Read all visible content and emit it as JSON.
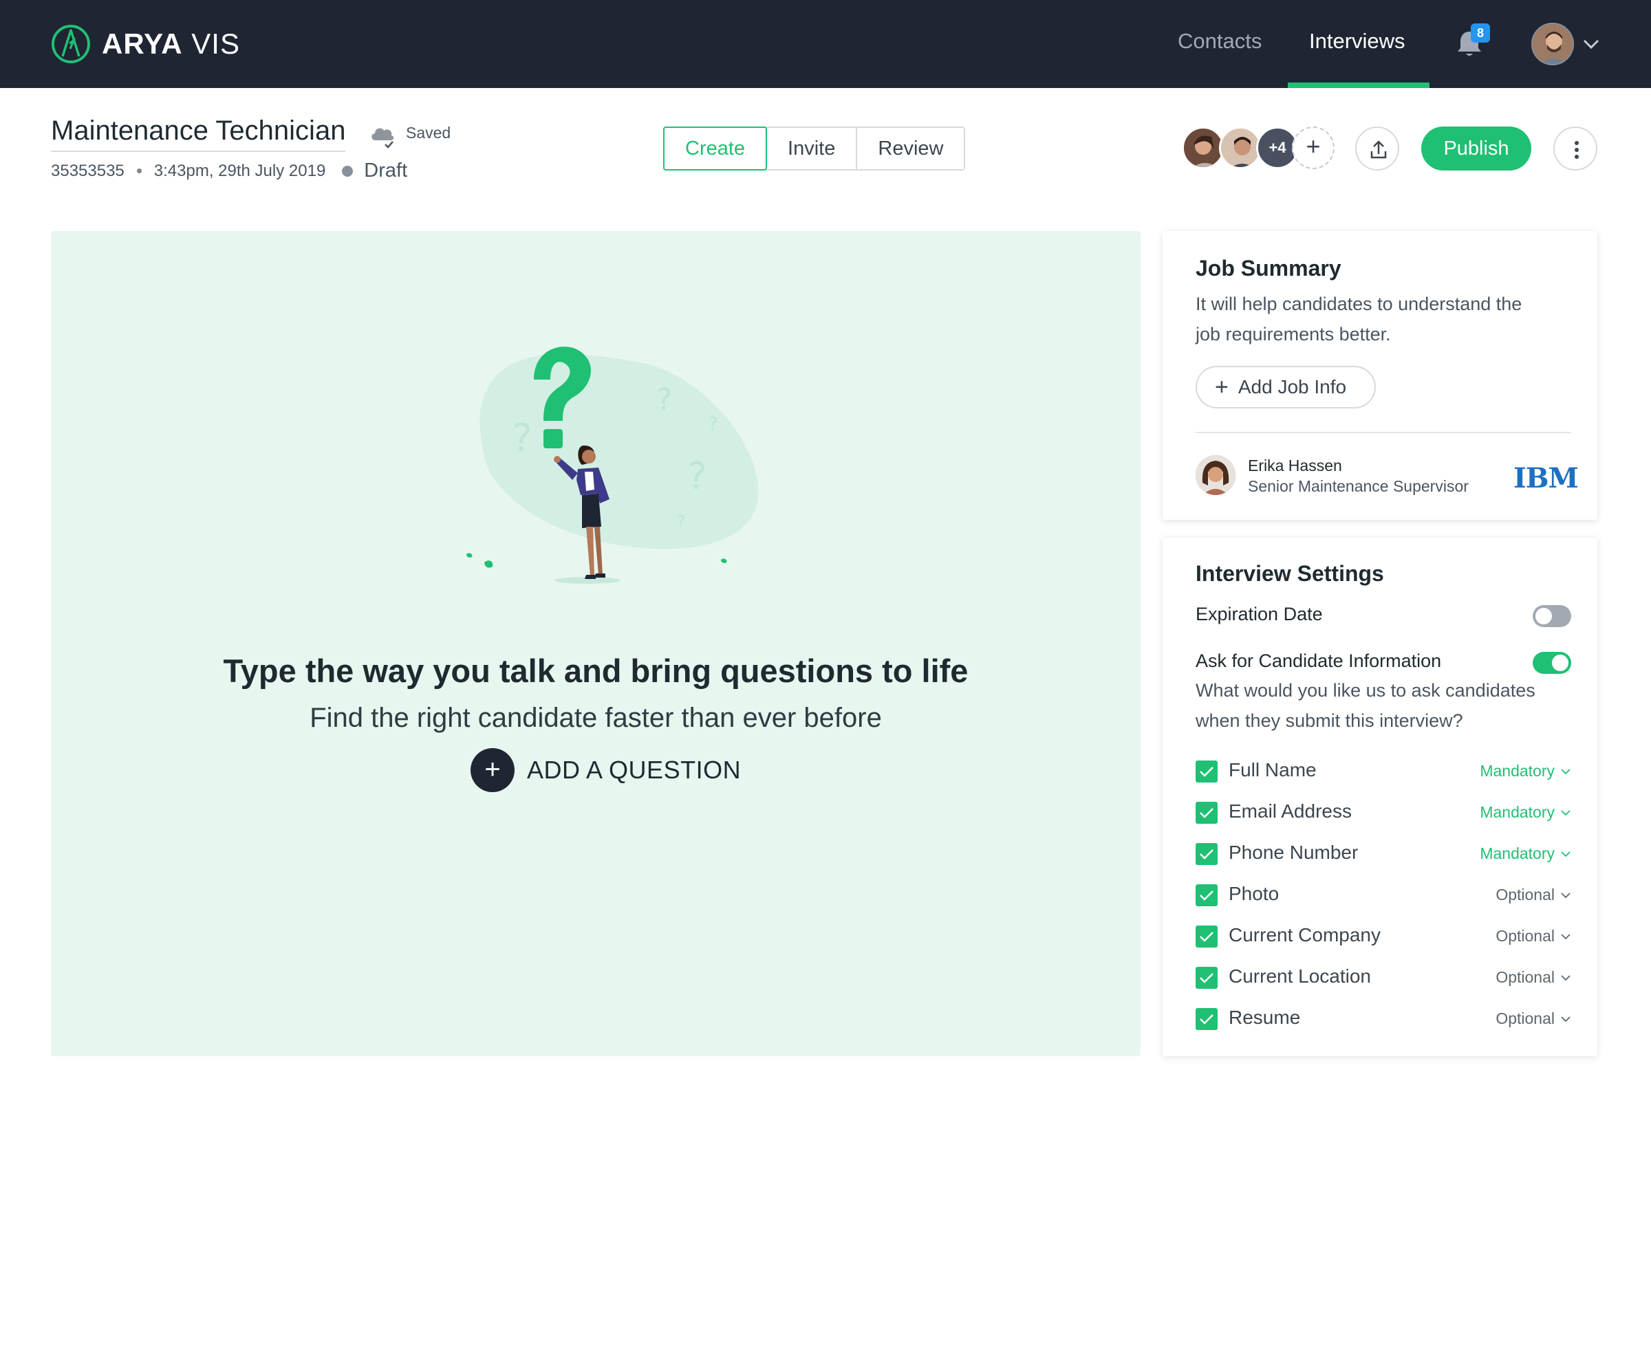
{
  "app": {
    "brand_bold": "ARYA",
    "brand_light": "VIS"
  },
  "nav": {
    "contacts": "Contacts",
    "interviews": "Interviews",
    "notification_count": "8"
  },
  "header": {
    "job_title": "Maintenance Technician",
    "save_status": "Saved",
    "job_id": "35353535",
    "timestamp": "3:43pm, 29th July 2019",
    "status": "Draft",
    "tabs": [
      "Create",
      "Invite",
      "Review"
    ],
    "collaborators_more": "+4",
    "add_collaborator": "+",
    "publish_label": "Publish"
  },
  "hero": {
    "title": "Type the way you talk and bring questions to life",
    "subtitle": "Find the right candidate faster than ever before",
    "add_question_label": "ADD A QUESTION",
    "add_question_icon": "+"
  },
  "job_summary": {
    "title": "Job Summary",
    "description_line1": "It will help candidates to understand the",
    "description_line2": "job requirements better.",
    "add_button_label": "Add Job Info",
    "add_button_icon": "+",
    "recruiter_name": "Erika Hassen",
    "recruiter_role": "Senior Maintenance Supervisor",
    "company_logo_text": "IBM"
  },
  "settings": {
    "title": "Interview Settings",
    "expiration_label": "Expiration Date",
    "expiration_enabled": false,
    "ask_info_label": "Ask for Candidate Information",
    "ask_info_enabled": true,
    "question_line1": "What would you like us to ask candidates",
    "question_line2": "when they submit this interview?",
    "fields": [
      {
        "name": "Full Name",
        "requirement": "Mandatory"
      },
      {
        "name": "Email Address",
        "requirement": "Mandatory"
      },
      {
        "name": "Phone Number",
        "requirement": "Mandatory"
      },
      {
        "name": "Photo",
        "requirement": "Optional"
      },
      {
        "name": "Current Company",
        "requirement": "Optional"
      },
      {
        "name": "Current Location",
        "requirement": "Optional"
      },
      {
        "name": "Resume",
        "requirement": "Optional"
      }
    ]
  },
  "colors": {
    "accent": "#1fc074",
    "nav_bg": "#1f2532",
    "hero_bg": "#e8f6f0",
    "badge": "#2196f3"
  }
}
